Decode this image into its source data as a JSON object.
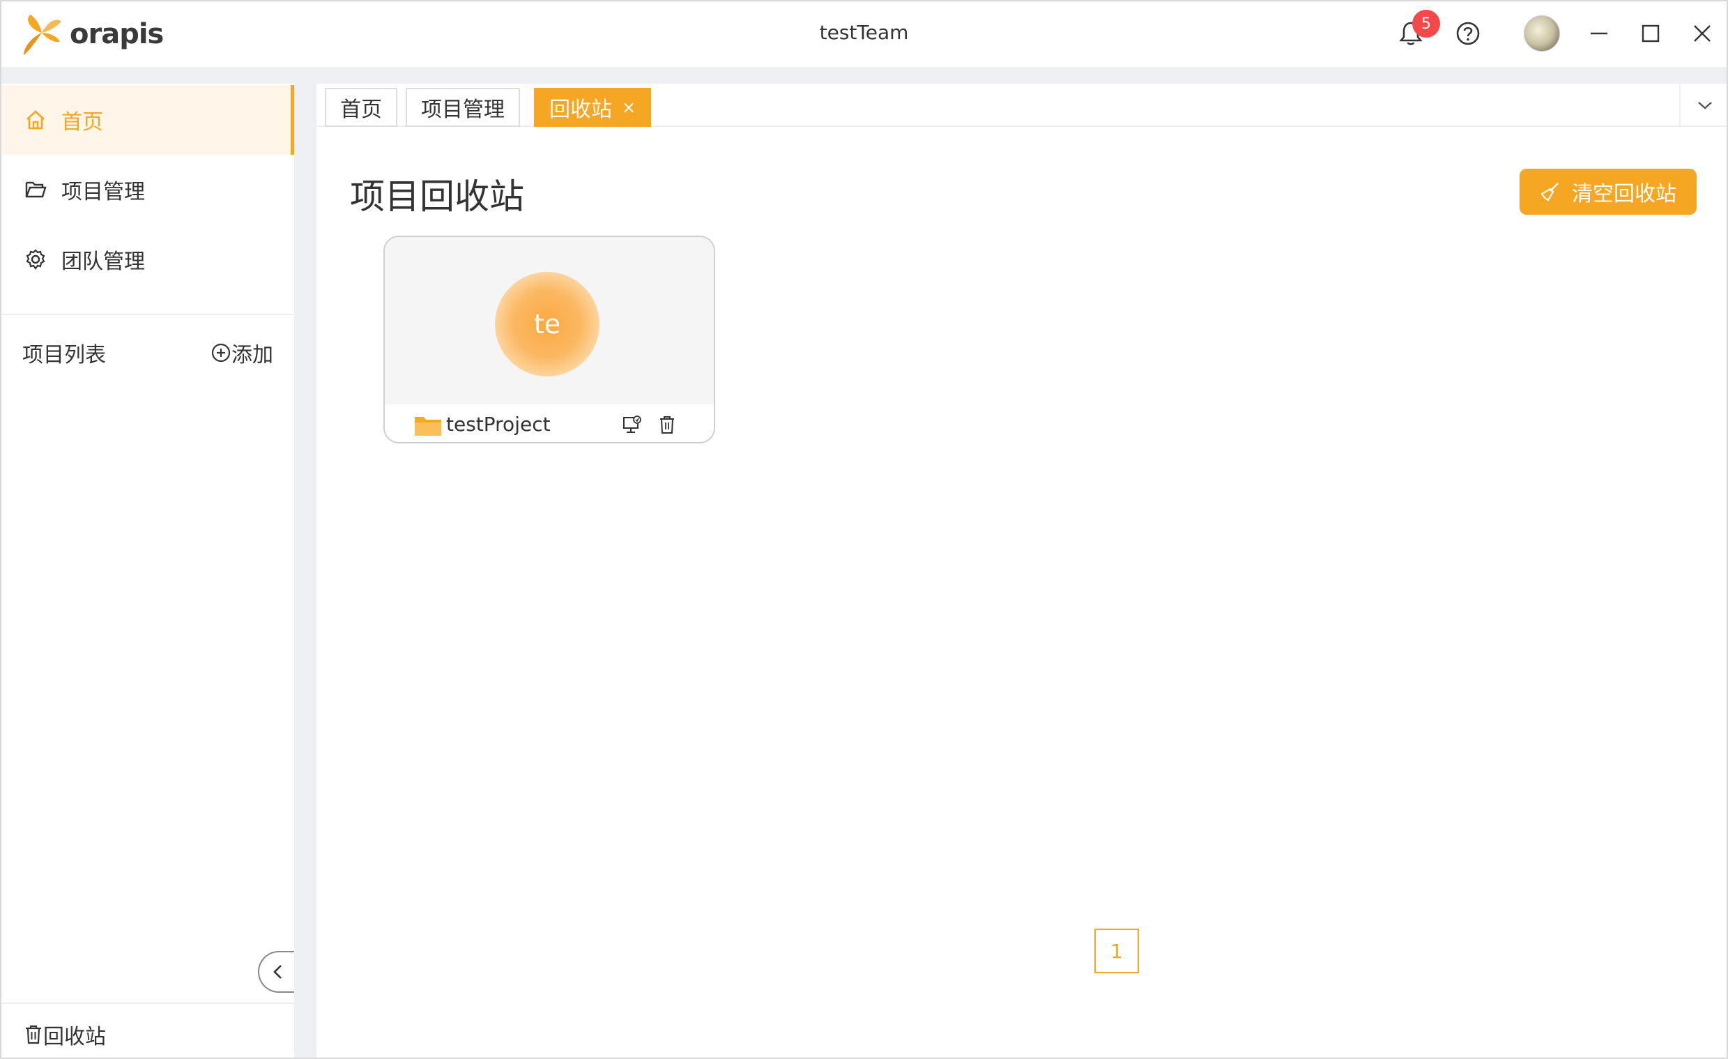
{
  "app": {
    "logo_text": "orapis",
    "window_title": "testTeam",
    "notification_count": "5"
  },
  "sidebar": {
    "items": [
      {
        "label": "首页",
        "icon": "home-icon",
        "active": true
      },
      {
        "label": "项目管理",
        "icon": "folder-open-icon",
        "active": false
      },
      {
        "label": "团队管理",
        "icon": "gear-icon",
        "active": false
      }
    ],
    "project_list_label": "项目列表",
    "add_label": "添加",
    "recycle_label": "回收站"
  },
  "tabs": [
    {
      "label": "首页",
      "active": false
    },
    {
      "label": "项目管理",
      "active": false
    },
    {
      "label": "回收站",
      "active": true,
      "close": "×"
    }
  ],
  "main": {
    "title": "项目回收站",
    "clear_button_label": "清空回收站",
    "projects": [
      {
        "avatar_text": "te",
        "name": "testProject"
      }
    ],
    "pagination": {
      "current_page": "1"
    }
  },
  "colors": {
    "accent": "#f5a623",
    "badge": "#f5484a",
    "band": "#eef0f3"
  }
}
